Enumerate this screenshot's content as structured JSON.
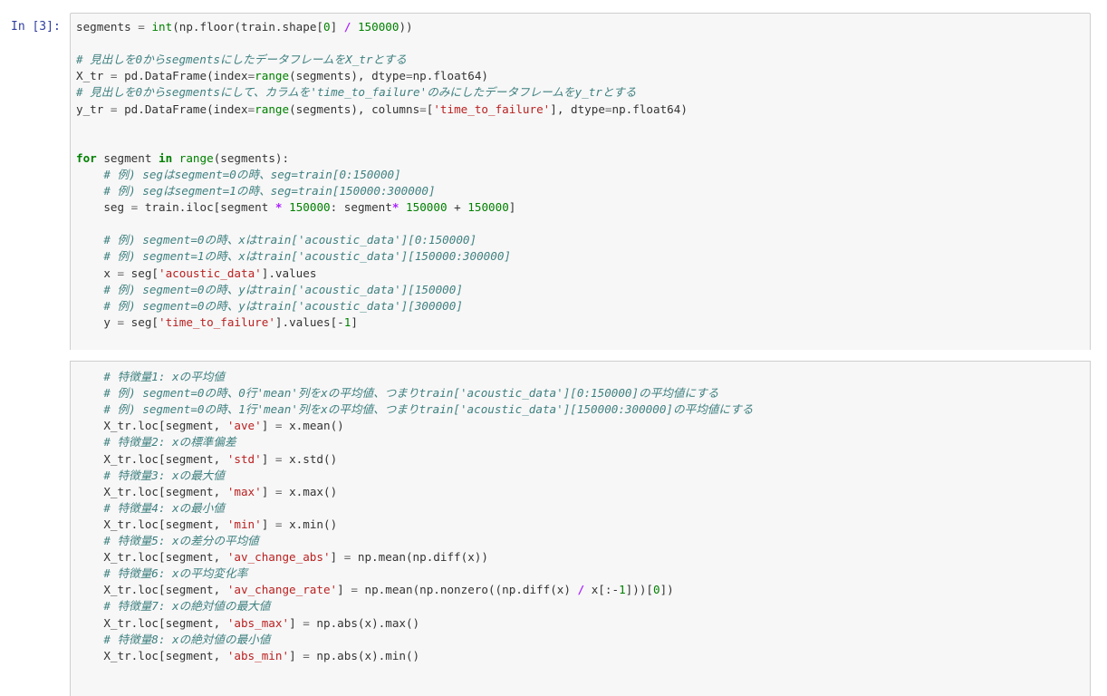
{
  "prompt": "In [3]:",
  "cell1_lines": [
    "segments = int(np.floor(train.shape[0] / 150000))",
    "",
    "# 見出しを0からsegmentsにしたデータフレームをX_trとする",
    "X_tr = pd.DataFrame(index=range(segments), dtype=np.float64)",
    "# 見出しを0からsegmentsにして、カラムを'time_to_failure'のみにしたデータフレームをy_trとする",
    "y_tr = pd.DataFrame(index=range(segments), columns=['time_to_failure'], dtype=np.float64)",
    "",
    "",
    "for segment in range(segments):",
    "    # 例) segはsegment=0の時、seg=train[0:150000]",
    "    # 例) segはsegment=1の時、seg=train[150000:300000]",
    "    seg = train.iloc[segment * 150000: segment* 150000 + 150000]",
    "",
    "    # 例) segment=0の時、xはtrain['acoustic_data'][0:150000]",
    "    # 例) segment=1の時、xはtrain['acoustic_data'][150000:300000]",
    "    x = seg['acoustic_data'].values",
    "    # 例) segment=0の時、yはtrain['acoustic_data'][150000]",
    "    # 例) segment=0の時、yはtrain['acoustic_data'][300000]",
    "    y = seg['time_to_failure'].values[-1]"
  ],
  "cell2_lines": [
    "    # 特徴量1: xの平均値",
    "    # 例) segment=0の時、0行'mean'列をxの平均値、つまりtrain['acoustic_data'][0:150000]の平均値にする",
    "    # 例) segment=0の時、1行'mean'列をxの平均値、つまりtrain['acoustic_data'][150000:300000]の平均値にする",
    "    X_tr.loc[segment, 'ave'] = x.mean()",
    "    # 特徴量2: xの標準偏差",
    "    X_tr.loc[segment, 'std'] = x.std()",
    "    # 特徴量3: xの最大値",
    "    X_tr.loc[segment, 'max'] = x.max()",
    "    # 特徴量4: xの最小値",
    "    X_tr.loc[segment, 'min'] = x.min()",
    "    # 特徴量5: xの差分の平均値",
    "    X_tr.loc[segment, 'av_change_abs'] = np.mean(np.diff(x))",
    "    # 特徴量6: xの平均変化率",
    "    X_tr.loc[segment, 'av_change_rate'] = np.mean(np.nonzero((np.diff(x) / x[:-1]))[0])",
    "    # 特徴量7: xの絶対値の最大値",
    "    X_tr.loc[segment, 'abs_max'] = np.abs(x).max()",
    "    # 特徴量8: xの絶対値の最小値",
    "    X_tr.loc[segment, 'abs_min'] = np.abs(x).min()"
  ]
}
